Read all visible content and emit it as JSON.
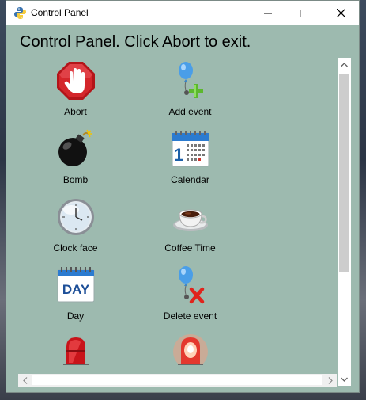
{
  "window": {
    "title": "Control Panel"
  },
  "heading": "Control Panel. Click Abort to exit.",
  "items": [
    {
      "label": "Abort",
      "icon": "stop-hand-icon"
    },
    {
      "label": "Add event",
      "icon": "balloon-add-icon"
    },
    {
      "label": "Bomb",
      "icon": "bomb-icon"
    },
    {
      "label": "Calendar",
      "icon": "calendar-icon"
    },
    {
      "label": "Clock face",
      "icon": "clock-face-icon"
    },
    {
      "label": "Coffee Time",
      "icon": "coffee-cup-icon"
    },
    {
      "label": "Day",
      "icon": "day-calendar-icon"
    },
    {
      "label": "Delete event",
      "icon": "balloon-delete-icon"
    },
    {
      "label": "",
      "icon": "red-siren-icon"
    },
    {
      "label": "",
      "icon": "lit-siren-icon"
    }
  ],
  "icon_text": {
    "calendar_number": "1",
    "day_word": "DAY"
  },
  "colors": {
    "panel_background": "#9dbaaf",
    "stop_red": "#d4262b",
    "balloon_blue": "#4a9ee8",
    "add_green": "#5cb82e",
    "delete_red": "#e0241c"
  }
}
